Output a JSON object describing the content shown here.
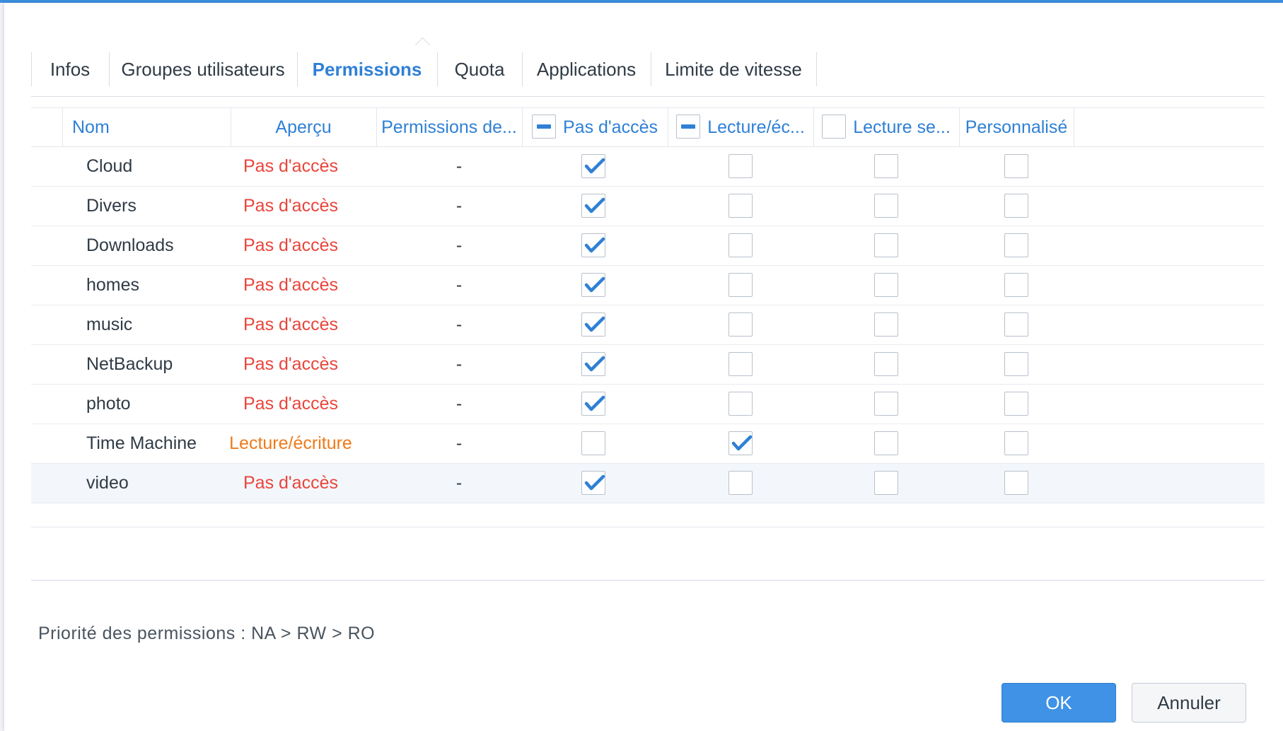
{
  "tabs": [
    {
      "label": "Infos",
      "active": false
    },
    {
      "label": "Groupes utilisateurs",
      "active": false
    },
    {
      "label": "Permissions",
      "active": true
    },
    {
      "label": "Quota",
      "active": false
    },
    {
      "label": "Applications",
      "active": false
    },
    {
      "label": "Limite de vitesse",
      "active": false
    }
  ],
  "columns": {
    "name": "Nom",
    "preview": "Aperçu",
    "group_perm": "Permissions de...",
    "no_access": "Pas d'accès",
    "read_write": "Lecture/éc...",
    "read_only": "Lecture se...",
    "custom": "Personnalisé"
  },
  "header_checks": {
    "no_access": "partial",
    "read_write": "partial",
    "read_only": "unchecked"
  },
  "rows": [
    {
      "name": "Cloud",
      "preview": "Pas d'accès",
      "preview_status": "none",
      "group_perm": "-",
      "na": true,
      "rw": false,
      "ro": false,
      "custom": false
    },
    {
      "name": "Divers",
      "preview": "Pas d'accès",
      "preview_status": "none",
      "group_perm": "-",
      "na": true,
      "rw": false,
      "ro": false,
      "custom": false
    },
    {
      "name": "Downloads",
      "preview": "Pas d'accès",
      "preview_status": "none",
      "group_perm": "-",
      "na": true,
      "rw": false,
      "ro": false,
      "custom": false
    },
    {
      "name": "homes",
      "preview": "Pas d'accès",
      "preview_status": "none",
      "group_perm": "-",
      "na": true,
      "rw": false,
      "ro": false,
      "custom": false
    },
    {
      "name": "music",
      "preview": "Pas d'accès",
      "preview_status": "none",
      "group_perm": "-",
      "na": true,
      "rw": false,
      "ro": false,
      "custom": false
    },
    {
      "name": "NetBackup",
      "preview": "Pas d'accès",
      "preview_status": "none",
      "group_perm": "-",
      "na": true,
      "rw": false,
      "ro": false,
      "custom": false
    },
    {
      "name": "photo",
      "preview": "Pas d'accès",
      "preview_status": "none",
      "group_perm": "-",
      "na": true,
      "rw": false,
      "ro": false,
      "custom": false
    },
    {
      "name": "Time Machine",
      "preview": "Lecture/écriture",
      "preview_status": "rw",
      "group_perm": "-",
      "na": false,
      "rw": true,
      "ro": false,
      "custom": false
    },
    {
      "name": "video",
      "preview": "Pas d'accès",
      "preview_status": "none",
      "group_perm": "-",
      "na": true,
      "rw": false,
      "ro": false,
      "custom": false,
      "selected": true
    }
  ],
  "priority_text": "Priorité des permissions : NA > RW > RO",
  "buttons": {
    "ok": "OK",
    "cancel": "Annuler"
  },
  "colors": {
    "accent": "#2f80d5",
    "no_access": "#e8453c",
    "read_write": "#ef7a1a",
    "ok_button": "#3f92e6"
  }
}
